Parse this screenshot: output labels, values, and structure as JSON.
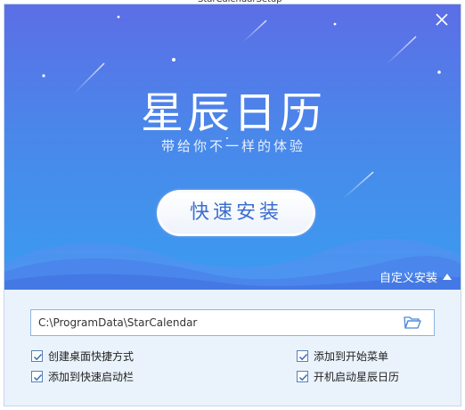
{
  "window": {
    "title": "星辰日历",
    "subtitle": "带给你不一样的体验",
    "install_button": "快速安装",
    "custom_install": "自定义安装"
  },
  "install_path": {
    "value": "C:\\ProgramData\\StarCalendar"
  },
  "options": [
    {
      "label": "创建桌面快捷方式",
      "checked": true
    },
    {
      "label": "添加到开始菜单",
      "checked": true
    },
    {
      "label": "添加到快速启动栏",
      "checked": true
    },
    {
      "label": "开机启动星辰日历",
      "checked": true
    }
  ],
  "colors": {
    "gradient_top": "#5c6ee6",
    "gradient_bottom": "#3a9cf0",
    "panel_bg": "#eaf3fc",
    "accent_text": "#3a6fd0"
  },
  "icons": [
    "close-icon",
    "folder-open-icon",
    "checkbox-checked-icon",
    "caret-up-icon"
  ]
}
